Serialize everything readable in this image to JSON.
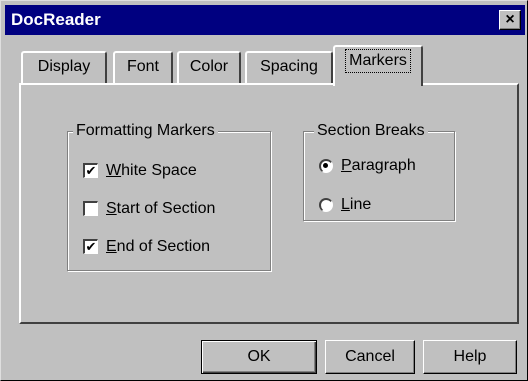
{
  "window": {
    "title": "DocReader",
    "close_glyph": "×"
  },
  "tabs": [
    {
      "label": "Display",
      "active": false
    },
    {
      "label": "Font",
      "active": false
    },
    {
      "label": "Color",
      "active": false
    },
    {
      "label": "Spacing",
      "active": false
    },
    {
      "label": "Markers",
      "active": true
    }
  ],
  "formatting_markers": {
    "title": "Formatting Markers",
    "items": [
      {
        "label": "White Space",
        "checked": true,
        "mark": "✔"
      },
      {
        "label": "Start of Section",
        "checked": false,
        "mark": ""
      },
      {
        "label": "End of Section",
        "checked": true,
        "mark": "✔"
      }
    ]
  },
  "section_breaks": {
    "title": "Section Breaks",
    "options": [
      {
        "label": "Paragraph",
        "selected": true
      },
      {
        "label": "Line",
        "selected": false
      }
    ]
  },
  "buttons": {
    "ok": "OK",
    "cancel": "Cancel",
    "help": "Help"
  },
  "colors": {
    "titlebar": "#000080",
    "face": "#c0c0c0"
  }
}
